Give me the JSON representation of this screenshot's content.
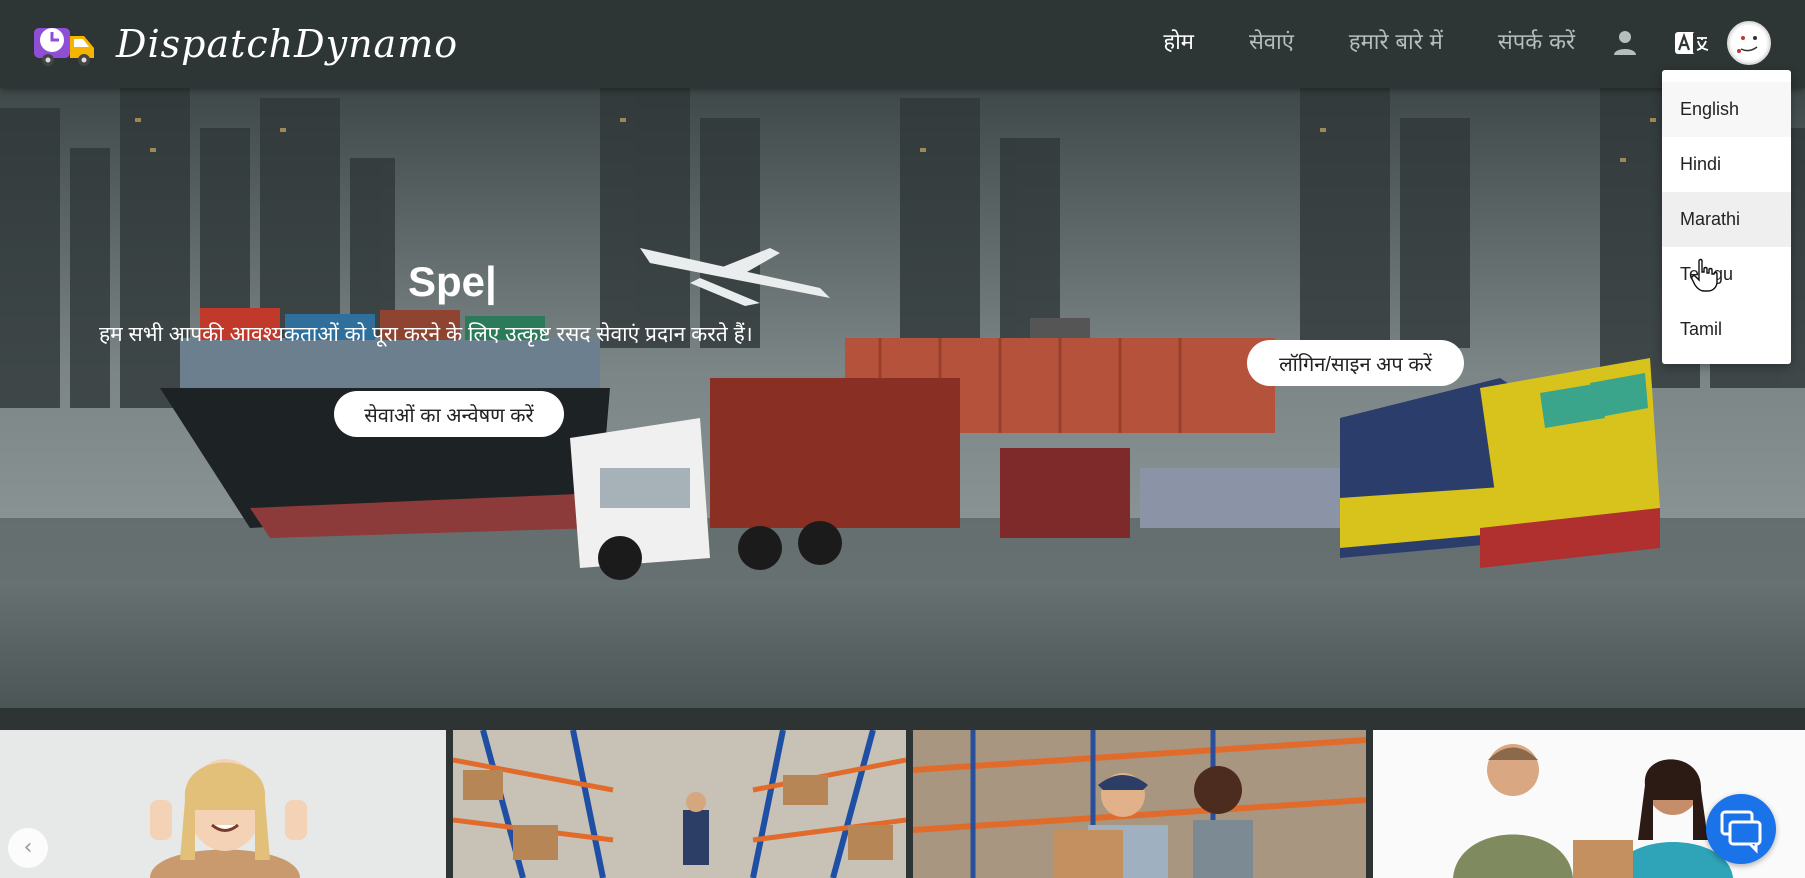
{
  "brand": {
    "name": "DispatchDynamo",
    "logo_icon": "truck-clock-logo"
  },
  "nav": {
    "items": [
      {
        "label": "होम",
        "active": true
      },
      {
        "label": "सेवाएं",
        "active": false
      },
      {
        "label": "हमारे बारे में",
        "active": false
      },
      {
        "label": "संपर्क करें",
        "active": false
      }
    ],
    "user_icon": "user-icon",
    "language_icon": "translate-icon",
    "avatar_icon": "avatar"
  },
  "hero": {
    "title": "Spe|",
    "subtitle": "हम सभी आपकी आवश्यकताओं को पूरा करने के लिए उत्कृष्ट रसद सेवाएं प्रदान करते हैं।",
    "explore_label": "सेवाओं का अन्वेषण करें",
    "login_label": "लॉगिन/साइन अप करें"
  },
  "language_menu": {
    "options": [
      "English",
      "Hindi",
      "Marathi",
      "Telugu",
      "Tamil"
    ],
    "hovered": "Marathi"
  },
  "carousel": {
    "prev_label": "‹",
    "cards": [
      "thumbs-up-woman",
      "warehouse-shelves",
      "warehouse-workers",
      "delivery-couple"
    ]
  },
  "colors": {
    "navbar": "#2e3535",
    "active_nav": "#ffffff",
    "inactive_nav": "#b7bcbc",
    "chat_button": "#1a73e8"
  }
}
